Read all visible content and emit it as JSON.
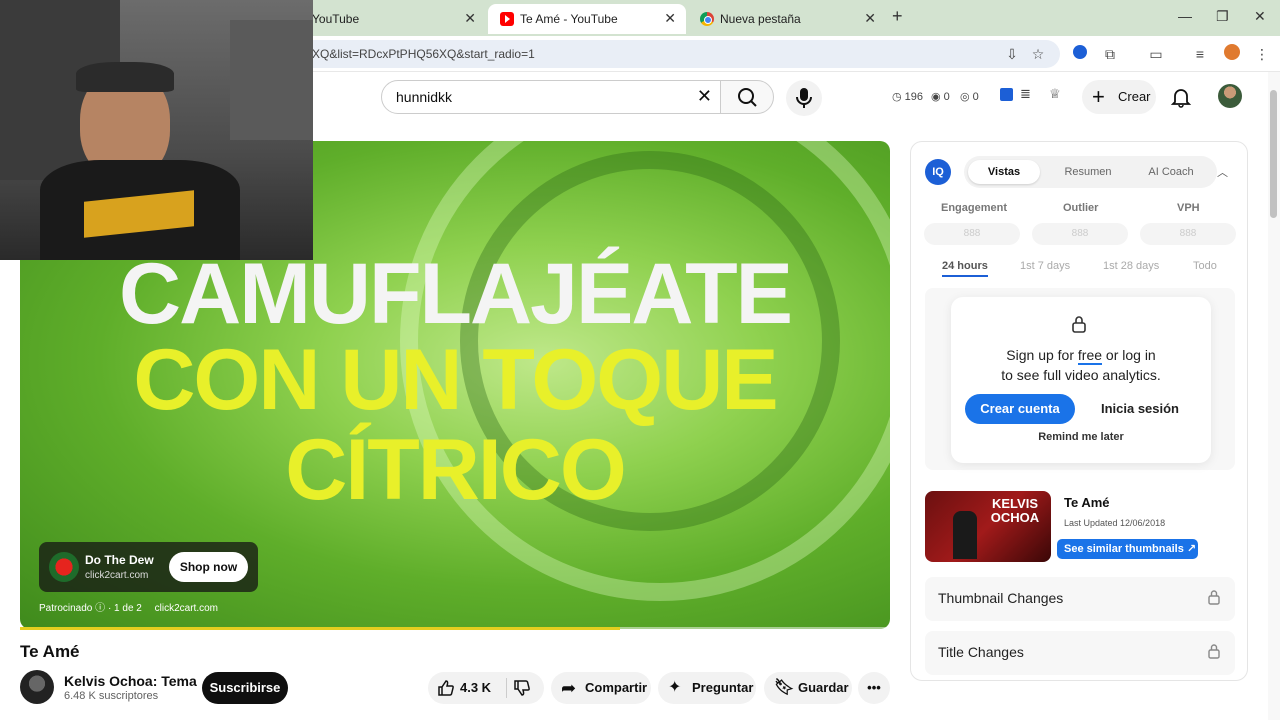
{
  "browser": {
    "tabs": [
      {
        "title": "YouTube",
        "active": false
      },
      {
        "title": "Te Amé - YouTube",
        "active": true
      },
      {
        "title": "Nueva pestaña",
        "active": false
      }
    ],
    "url": "XQ&list=RDcxPtPHQ56XQ&start_radio=1"
  },
  "header": {
    "search_value": "hunnidkk",
    "stats": {
      "views": "196",
      "a": "0",
      "b": "0"
    },
    "create_label": "Crear"
  },
  "video": {
    "headline_line1": "CAMUFLAJÉATE",
    "headline_line2": "CON UN TOQUE",
    "headline_line3": "CÍTRICO",
    "progress_fraction": 0.69,
    "ad": {
      "title": "Do The Dew",
      "domain": "click2cart.com",
      "cta": "Shop now",
      "sponsored": "Patrocinado",
      "count": "1 de 2",
      "meta_domain": "click2cart.com"
    }
  },
  "meta": {
    "title": "Te Amé",
    "channel": "Kelvis Ochoa: Tema",
    "subscribers": "6.48 K suscriptores",
    "subscribe": "Suscribirse",
    "likes": "4.3 K",
    "share": "Compartir",
    "ask": "Preguntar",
    "save": "Guardar"
  },
  "panel": {
    "logo": "IQ",
    "tabs": [
      "Vistas",
      "Resumen",
      "AI Coach"
    ],
    "metrics": [
      "Engagement",
      "Outlier",
      "VPH"
    ],
    "metric_value": "888",
    "ranges": [
      "24 hours",
      "1st 7 days",
      "1st 28 days",
      "Todo"
    ],
    "signup_line1a": "Sign up for ",
    "signup_free": "free",
    "signup_line1b": " or log in",
    "signup_line2": "to see full video analytics.",
    "create_account": "Crear cuenta",
    "login": "Inicia sesión",
    "remind": "Remind me later",
    "thumb_title": "Te Amé",
    "thumb_artist": "KELVIS OCHOA",
    "last_updated": "Last Updated 12/06/2018",
    "similar": "See similar thumbnails",
    "thumbnail_changes": "Thumbnail Changes",
    "title_changes": "Title Changes"
  },
  "colors": {
    "accent_blue": "#1a73e8",
    "video_green": "#5fae2a",
    "headline_yellow": "#e8f02a"
  }
}
